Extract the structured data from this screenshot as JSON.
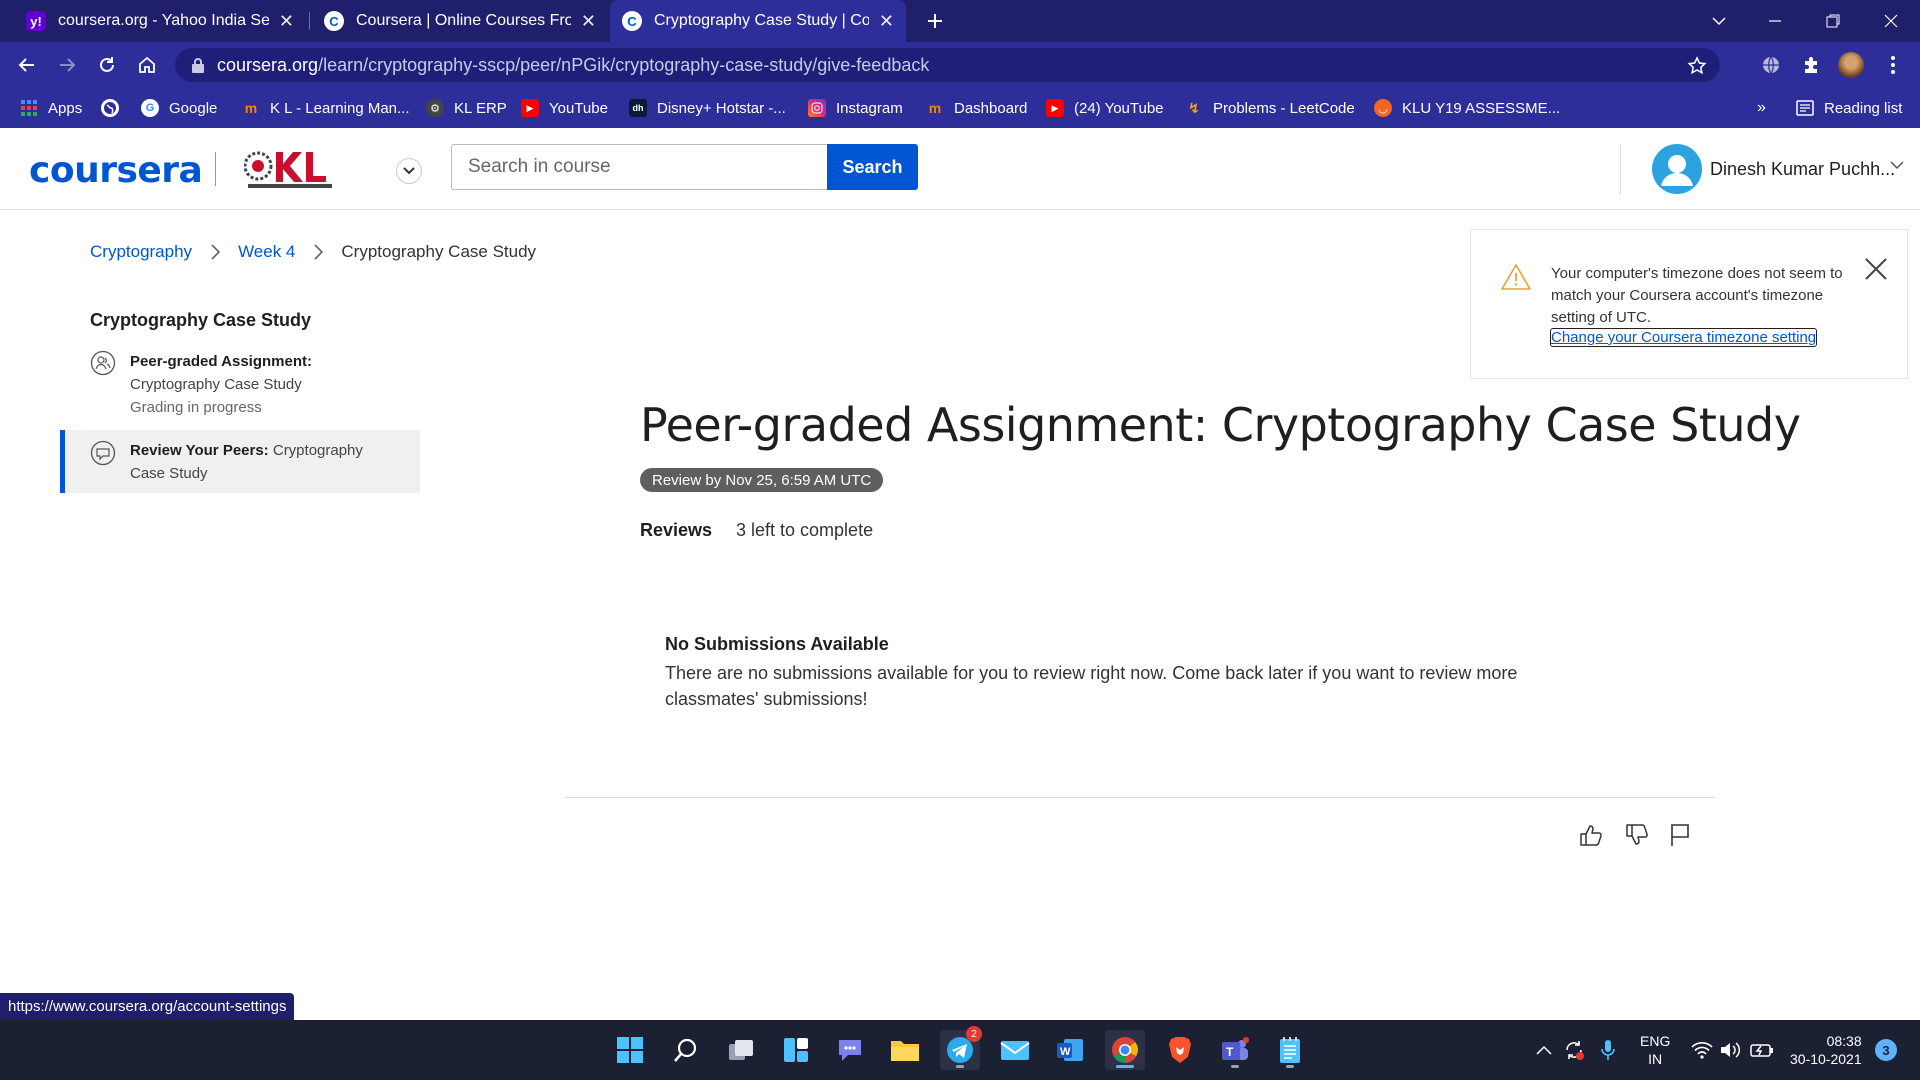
{
  "browser": {
    "tabs": [
      {
        "title": "coursera.org - Yahoo India Search",
        "favicon": "yahoo-favicon",
        "active": false
      },
      {
        "title": "Coursera | Online Courses From Top",
        "favicon": "coursera-favicon",
        "active": false
      },
      {
        "title": "Cryptography Case Study | Coursera",
        "favicon": "coursera-favicon",
        "active": true
      }
    ],
    "url_host": "coursera.org",
    "url_path": "/learn/cryptography-sscp/peer/nPGik/cryptography-case-study/give-feedback",
    "bookmarks": [
      {
        "label": "Apps",
        "icon": "apps-grid-icon"
      },
      {
        "label": "",
        "icon": "globe-icon"
      },
      {
        "label": "Google",
        "icon": "google-icon"
      },
      {
        "label": "K L - Learning Man...",
        "icon": "moodle-icon"
      },
      {
        "label": "KL ERP",
        "icon": "erp-icon"
      },
      {
        "label": "YouTube",
        "icon": "youtube-icon"
      },
      {
        "label": "Disney+ Hotstar -...",
        "icon": "hotstar-icon"
      },
      {
        "label": "Instagram",
        "icon": "instagram-icon"
      },
      {
        "label": "Dashboard",
        "icon": "moodle-icon"
      },
      {
        "label": "(24) YouTube",
        "icon": "youtube-icon"
      },
      {
        "label": "Problems - LeetCode",
        "icon": "leetcode-icon"
      },
      {
        "label": "KLU Y19 ASSESSME...",
        "icon": "assessment-icon"
      }
    ],
    "bookmarks_more": "»",
    "reading_list": "Reading list",
    "status_url": "https://www.coursera.org/account-settings"
  },
  "header": {
    "logo": "coursera",
    "search_placeholder": "Search in course",
    "search_button": "Search",
    "user_name": "Dinesh Kumar Puchh..."
  },
  "breadcrumb": {
    "items": [
      "Cryptography",
      "Week 4"
    ],
    "current": "Cryptography Case Study"
  },
  "sidebar": {
    "title": "Cryptography Case Study",
    "items": [
      {
        "bold": "Peer-graded Assignment:",
        "text": "Cryptography Case Study",
        "status": "Grading in progress"
      },
      {
        "bold": "Review Your Peers:",
        "text": " Cryptography Case Study"
      }
    ]
  },
  "timezone_banner": {
    "message": "Your computer's timezone does not seem to match your Coursera account's timezone setting of UTC.",
    "link": "Change your Coursera timezone setting"
  },
  "main": {
    "title": "Peer-graded Assignment: Cryptography Case Study",
    "due_badge": "Review by Nov 25, 6:59 AM UTC",
    "reviews_label": "Reviews",
    "reviews_count": "3 left to complete",
    "empty_title": "No Submissions Available",
    "empty_text": "There are no submissions available for you to review right now. Come back later if you want to review more classmates' submissions!"
  },
  "taskbar": {
    "lang_line1": "ENG",
    "lang_line2": "IN",
    "time": "08:38",
    "date": "30-10-2021",
    "notification_count": "3",
    "telegram_badge": "2"
  },
  "colors": {
    "brand": "#0056d2",
    "browser_frame": "#1f1f6b",
    "browser_toolbar": "#2e2e9a",
    "taskbar": "#1c2033"
  }
}
